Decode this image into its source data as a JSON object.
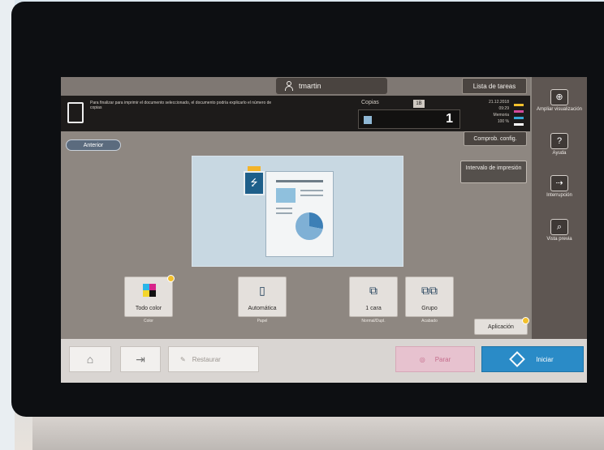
{
  "header": {
    "user_name": "tmartin",
    "job_list_label": "Lista de tareas"
  },
  "info": {
    "message": "Para finalizar para imprimir el documento seleccionado, el documento podría explicarlo el número de copias",
    "copies_label": "Copias",
    "copies_badge": "1B",
    "copies_value": "1",
    "status_lines": [
      "21.12.2018",
      "09:29",
      "Memoria",
      "100 %"
    ],
    "toner_colors": [
      "#f3c02c",
      "#d44a9d",
      "#39a7d8",
      "#222222"
    ]
  },
  "main": {
    "back_label": "Anterior",
    "comp_cont_label": "Comprob. config.",
    "print_interrupt_label": "Intervalo de impresión",
    "applications_label": "Aplicación",
    "func_buttons": [
      {
        "label": "Todo color",
        "caption": "Color"
      },
      {
        "label": "Automática",
        "caption": "Papel"
      },
      {
        "label": "1 cara",
        "caption": "Normal/Dupl."
      },
      {
        "label": "Grupo",
        "caption": "Acabado"
      }
    ]
  },
  "rightbar": {
    "zoom_label": "Ampliar visualización",
    "help_label": "Ayuda",
    "interrupt_label": "Interrupción",
    "preview_label": "Vista previa"
  },
  "bottombar": {
    "reset_label": "Restaurar",
    "stop_label": "Parar",
    "start_label": "Iniciar"
  },
  "colors": {
    "accent_start": "#2a8bc7",
    "stop_pink": "#e7c2cf"
  }
}
